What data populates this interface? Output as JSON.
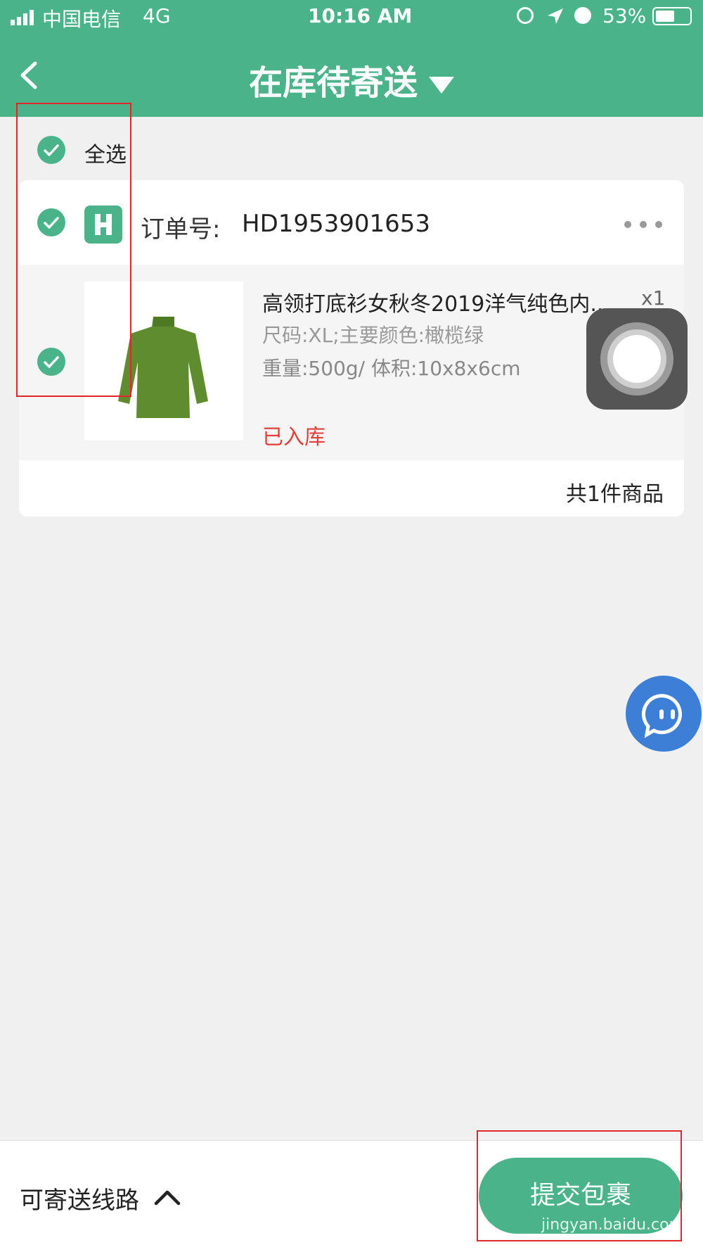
{
  "status_bar": {
    "carrier": "中国电信",
    "network": "4G",
    "time": "10:16 AM",
    "battery": "53%"
  },
  "header": {
    "title": "在库待寄送"
  },
  "select_all": {
    "label": "全选"
  },
  "order": {
    "number_label": "订单号:",
    "number": "HD1953901653",
    "product": {
      "title": "高领打底衫女秋冬2019洋气纯色内...",
      "quantity": "x1",
      "spec": "尺码:XL;主要颜色:橄榄绿",
      "weight_volume": "重量:500g/ 体积:10x8x6cm",
      "status": "已入库"
    },
    "summary": "共1件商品"
  },
  "bottom_bar": {
    "route_label": "可寄送线路",
    "submit_label": "提交包裹"
  },
  "watermark": "jingyan.baidu.com",
  "colors": {
    "brand_green": "#4ab38a",
    "status_red": "#e0403a",
    "chat_blue": "#3d7fd6"
  }
}
